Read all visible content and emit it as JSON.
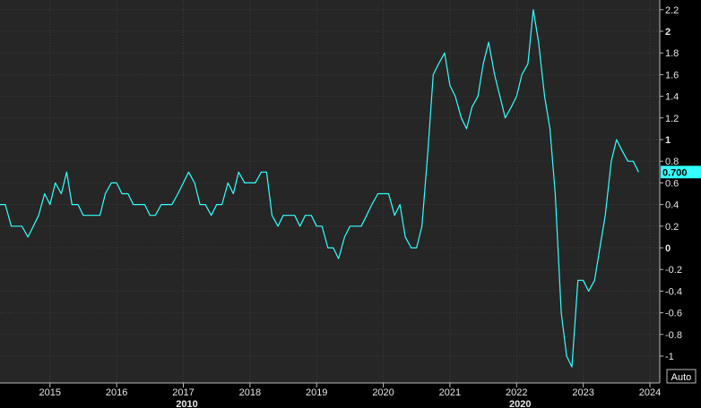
{
  "chart_data": {
    "type": "line",
    "title": "",
    "xlabel": "",
    "ylabel": "",
    "ylim": [
      -1.2,
      2.3
    ],
    "y_ticks": [
      -1,
      -0.8,
      -0.6,
      -0.4,
      -0.2,
      0,
      0.2,
      0.4,
      0.6,
      0.8,
      1,
      1.2,
      1.4,
      1.6,
      1.8,
      2,
      2.2
    ],
    "y_tick_labels": [
      "-1",
      "-0.8",
      "-0.6",
      "-0.4",
      "-0.2",
      "0",
      "0.2",
      "0.4",
      "0.6",
      "0.8",
      "1",
      "1.2",
      "1.4",
      "1.6",
      "1.8",
      "2",
      "2.2"
    ],
    "major_y_ticks": [
      0,
      1,
      2
    ],
    "x_ticks": [
      2015,
      2016,
      2017,
      2018,
      2019,
      2020,
      2021,
      2022,
      2023,
      2024
    ],
    "x_tick_labels": [
      "2015",
      "2016",
      "2017",
      "2018",
      "2019",
      "2020",
      "2021",
      "2022",
      "2023",
      "2024"
    ],
    "decade_labels": [
      {
        "x": 2017.0,
        "label": "2010"
      },
      {
        "x": 2022.0,
        "label": "2020"
      }
    ],
    "grid": true,
    "series": [
      {
        "color": "#33ffff",
        "points": [
          [
            2014.25,
            0.4
          ],
          [
            2014.33,
            0.4
          ],
          [
            2014.42,
            0.2
          ],
          [
            2014.5,
            0.2
          ],
          [
            2014.58,
            0.2
          ],
          [
            2014.67,
            0.1
          ],
          [
            2014.75,
            0.2
          ],
          [
            2014.83,
            0.3
          ],
          [
            2014.92,
            0.5
          ],
          [
            2015.0,
            0.4
          ],
          [
            2015.08,
            0.6
          ],
          [
            2015.17,
            0.5
          ],
          [
            2015.25,
            0.7
          ],
          [
            2015.33,
            0.4
          ],
          [
            2015.42,
            0.4
          ],
          [
            2015.5,
            0.3
          ],
          [
            2015.58,
            0.3
          ],
          [
            2015.67,
            0.3
          ],
          [
            2015.75,
            0.3
          ],
          [
            2015.83,
            0.5
          ],
          [
            2015.92,
            0.6
          ],
          [
            2016.0,
            0.6
          ],
          [
            2016.08,
            0.5
          ],
          [
            2016.17,
            0.5
          ],
          [
            2016.25,
            0.4
          ],
          [
            2016.33,
            0.4
          ],
          [
            2016.42,
            0.4
          ],
          [
            2016.5,
            0.3
          ],
          [
            2016.58,
            0.3
          ],
          [
            2016.67,
            0.4
          ],
          [
            2016.75,
            0.4
          ],
          [
            2016.83,
            0.4
          ],
          [
            2016.92,
            0.5
          ],
          [
            2017.0,
            0.6
          ],
          [
            2017.08,
            0.7
          ],
          [
            2017.17,
            0.6
          ],
          [
            2017.25,
            0.4
          ],
          [
            2017.33,
            0.4
          ],
          [
            2017.42,
            0.3
          ],
          [
            2017.5,
            0.4
          ],
          [
            2017.58,
            0.4
          ],
          [
            2017.67,
            0.6
          ],
          [
            2017.75,
            0.5
          ],
          [
            2017.83,
            0.7
          ],
          [
            2017.92,
            0.6
          ],
          [
            2018.0,
            0.6
          ],
          [
            2018.08,
            0.6
          ],
          [
            2018.17,
            0.7
          ],
          [
            2018.25,
            0.7
          ],
          [
            2018.33,
            0.3
          ],
          [
            2018.42,
            0.2
          ],
          [
            2018.5,
            0.3
          ],
          [
            2018.58,
            0.3
          ],
          [
            2018.67,
            0.3
          ],
          [
            2018.75,
            0.2
          ],
          [
            2018.83,
            0.3
          ],
          [
            2018.92,
            0.3
          ],
          [
            2019.0,
            0.2
          ],
          [
            2019.08,
            0.2
          ],
          [
            2019.17,
            0.0
          ],
          [
            2019.25,
            0.0
          ],
          [
            2019.33,
            -0.1
          ],
          [
            2019.42,
            0.1
          ],
          [
            2019.5,
            0.2
          ],
          [
            2019.58,
            0.2
          ],
          [
            2019.67,
            0.2
          ],
          [
            2019.75,
            0.3
          ],
          [
            2019.83,
            0.4
          ],
          [
            2019.92,
            0.5
          ],
          [
            2020.0,
            0.5
          ],
          [
            2020.08,
            0.5
          ],
          [
            2020.17,
            0.3
          ],
          [
            2020.25,
            0.4
          ],
          [
            2020.33,
            0.1
          ],
          [
            2020.42,
            0.0
          ],
          [
            2020.5,
            0.0
          ],
          [
            2020.58,
            0.2
          ],
          [
            2020.67,
            0.9
          ],
          [
            2020.75,
            1.6
          ],
          [
            2020.83,
            1.7
          ],
          [
            2020.92,
            1.8
          ],
          [
            2021.0,
            1.5
          ],
          [
            2021.08,
            1.4
          ],
          [
            2021.17,
            1.2
          ],
          [
            2021.25,
            1.1
          ],
          [
            2021.33,
            1.3
          ],
          [
            2021.42,
            1.4
          ],
          [
            2021.5,
            1.7
          ],
          [
            2021.58,
            1.9
          ],
          [
            2021.67,
            1.6
          ],
          [
            2021.75,
            1.4
          ],
          [
            2021.83,
            1.2
          ],
          [
            2021.92,
            1.3
          ],
          [
            2022.0,
            1.4
          ],
          [
            2022.08,
            1.6
          ],
          [
            2022.17,
            1.7
          ],
          [
            2022.25,
            2.2
          ],
          [
            2022.33,
            1.9
          ],
          [
            2022.42,
            1.4
          ],
          [
            2022.5,
            1.1
          ],
          [
            2022.58,
            0.5
          ],
          [
            2022.67,
            -0.6
          ],
          [
            2022.75,
            -1.0
          ],
          [
            2022.83,
            -1.1
          ],
          [
            2022.92,
            -0.3
          ],
          [
            2023.0,
            -0.3
          ],
          [
            2023.08,
            -0.4
          ],
          [
            2023.17,
            -0.3
          ],
          [
            2023.25,
            0.0
          ],
          [
            2023.33,
            0.3
          ],
          [
            2023.42,
            0.8
          ],
          [
            2023.5,
            1.0
          ],
          [
            2023.58,
            0.9
          ],
          [
            2023.67,
            0.8
          ],
          [
            2023.75,
            0.8
          ],
          [
            2023.83,
            0.7
          ]
        ]
      }
    ],
    "last_value_label": "0.700",
    "last_value": 0.7
  },
  "ui": {
    "auto_button_label": "Auto"
  }
}
